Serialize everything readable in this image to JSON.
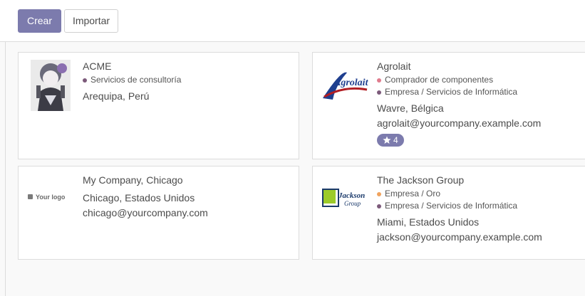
{
  "toolbar": {
    "create_label": "Crear",
    "import_label": "Importar"
  },
  "colors": {
    "accent": "#7c7bad"
  },
  "cards": [
    {
      "title": "ACME",
      "tags": [
        {
          "label": "Servicios de consultoría",
          "color": "#7c5a7a"
        }
      ],
      "location": "Arequipa, Perú",
      "image": "avatar-anime-portrait"
    },
    {
      "title": "Agrolait",
      "tags": [
        {
          "label": "Comprador de componentes",
          "color": "#e07b8d"
        },
        {
          "label": "Empresa / Servicios de Informática",
          "color": "#7c5a7a"
        }
      ],
      "location": "Wavre, Bélgica",
      "email": "agrolait@yourcompany.example.com",
      "badge_count": "4",
      "logo_text": "Agrolait",
      "image": "agrolait-logo"
    },
    {
      "title": "My Company, Chicago",
      "location": "Chicago, Estados Unidos",
      "email": "chicago@yourcompany.com",
      "logo_text": "Your logo",
      "image": "your-logo-placeholder"
    },
    {
      "title": "The Jackson Group",
      "tags": [
        {
          "label": "Empresa / Oro",
          "color": "#f0a35e"
        },
        {
          "label": "Empresa / Servicios de Informática",
          "color": "#7c5a7a"
        }
      ],
      "location": "Miami, Estados Unidos",
      "email": "jackson@yourcompany.example.com",
      "logo_text_1": "Jackson",
      "logo_text_2": "Group",
      "image": "jackson-group-logo"
    }
  ]
}
